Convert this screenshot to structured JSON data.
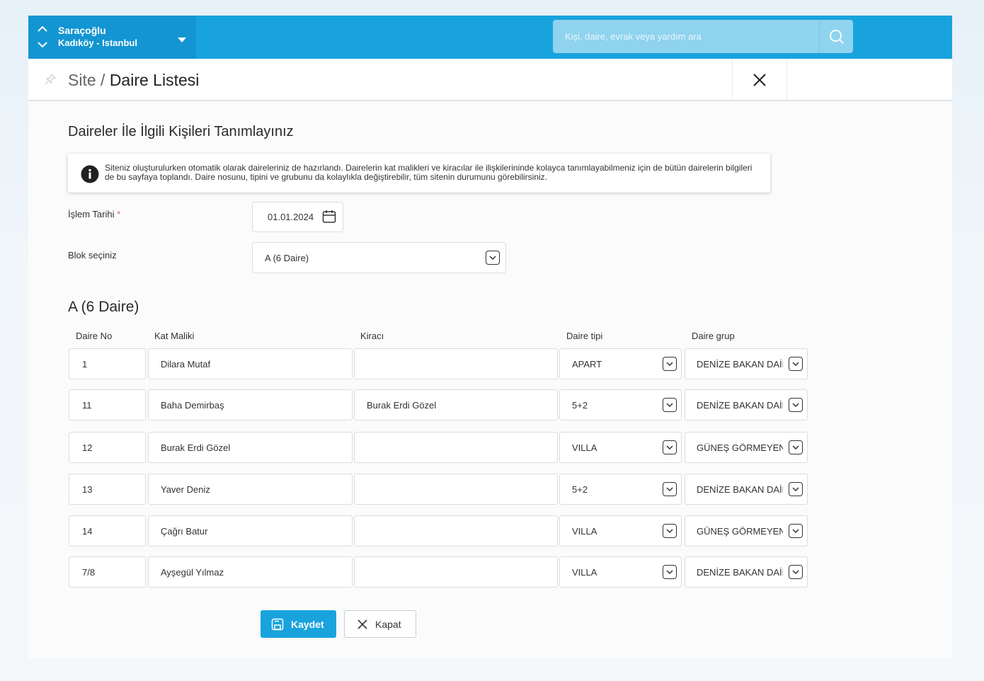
{
  "topbar": {
    "site_name": "Saraçoğlu",
    "site_location": "Kadıköy - Istanbul",
    "search_placeholder": "Kişi, daire, evrak veya yardım ara"
  },
  "breadcrumb": {
    "parent": "Site",
    "separator": " / ",
    "current": "Daire Listesi"
  },
  "page": {
    "heading": "Daireler İle İlgili Kişileri Tanımlayınız",
    "info_text": "Siteniz oluşturulurken otomatik olarak daireleriniz de hazırlandı. Dairelerin kat malikleri ve kiracılar ile ilişkilerininde kolayca tanımlayabilmeniz için de bütün dairelerin bilgileri de bu sayfaya toplandı. Daire nosunu, tipini ve grubunu da kolaylıkla değiştirebilir, tüm sitenin durumunu görebilirsiniz."
  },
  "form": {
    "date_label": "İşlem Tarihi",
    "required_mark": "*",
    "date_value": "01.01.2024",
    "block_label": "Blok seçiniz",
    "block_value": "A (6 Daire)"
  },
  "table": {
    "title": "A (6 Daire)",
    "headers": {
      "no": "Daire No",
      "owner": "Kat Maliki",
      "tenant": "Kiracı",
      "type": "Daire tipi",
      "group": "Daire grup"
    },
    "rows": [
      {
        "no": "1",
        "owner": "Dilara Mutaf",
        "tenant": "",
        "type": "APART",
        "group": "DENİZE BAKAN DAİRE"
      },
      {
        "no": "11",
        "owner": "Baha Demirbaş",
        "tenant": "Burak Erdi Gözel",
        "type": "5+2",
        "group": "DENİZE BAKAN DAİRE"
      },
      {
        "no": "12",
        "owner": "Burak Erdi Gözel",
        "tenant": "",
        "type": "VILLA",
        "group": "GÜNEŞ GÖRMEYEN"
      },
      {
        "no": "13",
        "owner": "Yaver Deniz",
        "tenant": "",
        "type": "5+2",
        "group": "DENİZE BAKAN DAİRE"
      },
      {
        "no": "14",
        "owner": "Çağrı Batur",
        "tenant": "",
        "type": "VILLA",
        "group": "GÜNEŞ GÖRMEYEN"
      },
      {
        "no": "7/8",
        "owner": "Ayşegül Yılmaz",
        "tenant": "",
        "type": "VILLA",
        "group": "DENİZE BAKAN DAİRE"
      }
    ]
  },
  "actions": {
    "save_label": "Kaydet",
    "close_label": "Kapat"
  },
  "colors": {
    "primary": "#18a3dd",
    "primary_dark": "#1395d1",
    "search_bg": "#8fd3ef"
  }
}
